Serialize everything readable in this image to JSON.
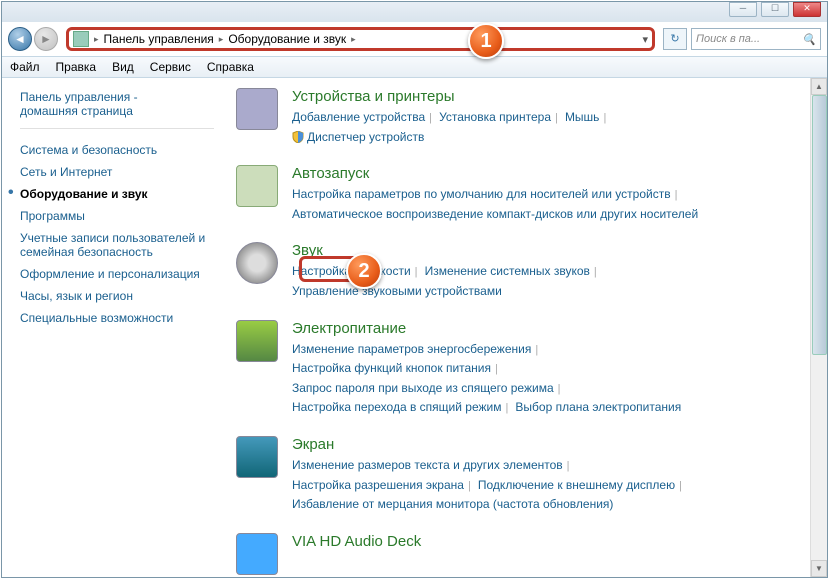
{
  "breadcrumb": {
    "root": "Панель управления",
    "current": "Оборудование и звук"
  },
  "search": {
    "placeholder": "Поиск в па..."
  },
  "menu": {
    "file": "Файл",
    "edit": "Правка",
    "view": "Вид",
    "service": "Сервис",
    "help": "Справка"
  },
  "sidebar": {
    "home1": "Панель управления -",
    "home2": "домашняя страница",
    "items": [
      "Система и безопасность",
      "Сеть и Интернет",
      "Оборудование и звук",
      "Программы",
      "Учетные записи пользователей и семейная безопасность",
      "Оформление и персонализация",
      "Часы, язык и регион",
      "Специальные возможности"
    ]
  },
  "categories": {
    "devices": {
      "title": "Устройства и принтеры",
      "l1": "Добавление устройства",
      "l2": "Установка принтера",
      "l3": "Мышь",
      "l4": "Диспетчер устройств"
    },
    "autoplay": {
      "title": "Автозапуск",
      "l1": "Настройка параметров по умолчанию для носителей или устройств",
      "l2": "Автоматическое воспроизведение компакт-дисков или других носителей"
    },
    "sound": {
      "title": "Звук",
      "l1": "Настройка громкости",
      "l2": "Изменение системных звуков",
      "l3": "Управление звуковыми устройствами"
    },
    "power": {
      "title": "Электропитание",
      "l1": "Изменение параметров энергосбережения",
      "l2": "Настройка функций кнопок питания",
      "l3": "Запрос пароля при выходе из спящего режима",
      "l4": "Настройка перехода в спящий режим",
      "l5": "Выбор плана электропитания"
    },
    "display": {
      "title": "Экран",
      "l1": "Изменение размеров текста и других элементов",
      "l2": "Настройка разрешения экрана",
      "l3": "Подключение к внешнему дисплею",
      "l4": "Избавление от мерцания монитора (частота обновления)"
    },
    "via": {
      "title": "VIA HD Audio Deck"
    }
  },
  "callouts": {
    "one": "1",
    "two": "2"
  }
}
